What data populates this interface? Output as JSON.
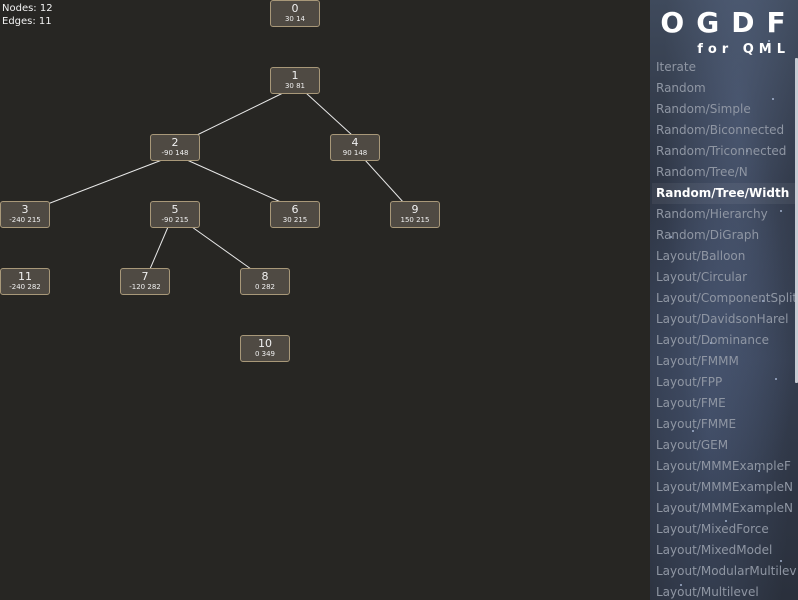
{
  "stats": {
    "nodes": "Nodes: 12",
    "edges": "Edges: 11"
  },
  "nodes": [
    {
      "id": "0",
      "coord": "30 14"
    },
    {
      "id": "1",
      "coord": "30 81"
    },
    {
      "id": "2",
      "coord": "-90 148"
    },
    {
      "id": "4",
      "coord": "90 148"
    },
    {
      "id": "3",
      "coord": "-240 215"
    },
    {
      "id": "5",
      "coord": "-90 215"
    },
    {
      "id": "6",
      "coord": "30 215"
    },
    {
      "id": "9",
      "coord": "150 215"
    },
    {
      "id": "11",
      "coord": "-240 282"
    },
    {
      "id": "7",
      "coord": "-120 282"
    },
    {
      "id": "8",
      "coord": "0 282"
    },
    {
      "id": "10",
      "coord": "0 349"
    }
  ],
  "sidebar": {
    "logo": "OGDF",
    "subtitle": "for QML",
    "items": [
      {
        "label": "Iterate"
      },
      {
        "label": "Random"
      },
      {
        "label": "Random/Simple"
      },
      {
        "label": "Random/Biconnected"
      },
      {
        "label": "Random/Triconnected"
      },
      {
        "label": "Random/Tree/N"
      },
      {
        "label": "Random/Tree/Width",
        "selected": true
      },
      {
        "label": "Random/Hierarchy"
      },
      {
        "label": "Random/DiGraph"
      },
      {
        "label": "Layout/Balloon"
      },
      {
        "label": "Layout/Circular"
      },
      {
        "label": "Layout/ComponentSplit"
      },
      {
        "label": "Layout/DavidsonHarel"
      },
      {
        "label": "Layout/Dominance"
      },
      {
        "label": "Layout/FMMM"
      },
      {
        "label": "Layout/FPP"
      },
      {
        "label": "Layout/FME"
      },
      {
        "label": "Layout/FMME"
      },
      {
        "label": "Layout/GEM"
      },
      {
        "label": "Layout/MMMExampleF"
      },
      {
        "label": "Layout/MMMExampleN"
      },
      {
        "label": "Layout/MMMExampleN"
      },
      {
        "label": "Layout/MixedForce"
      },
      {
        "label": "Layout/MixedModel"
      },
      {
        "label": "Layout/ModularMultilev"
      },
      {
        "label": "Layout/Multilevel"
      }
    ]
  }
}
